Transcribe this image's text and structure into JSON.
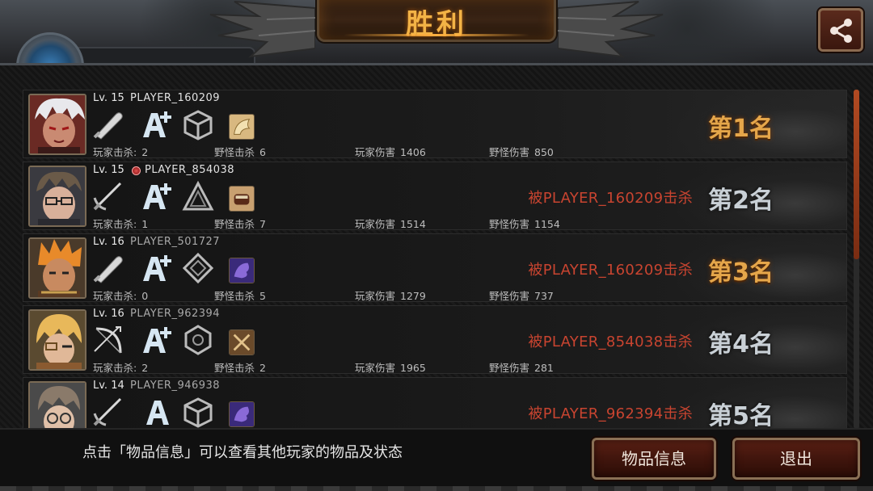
{
  "header": {
    "title": "胜利",
    "share_icon": "share-icon"
  },
  "colors": {
    "accent": "#f3b346",
    "killed_text": "#c84430",
    "button_bg": "#4a1a10"
  },
  "players": [
    {
      "level": "Lv. 15",
      "name": "PLAYER_160209",
      "is_self": false,
      "weapon": "bat-icon",
      "grade": "A+",
      "emblem": "cube-emblem-icon",
      "item": "wing-item-icon",
      "player_kills_label": "玩家击杀:",
      "player_kills": "2",
      "monster_kills_label": "野怪击杀",
      "monster_kills": "6",
      "player_damage_label": "玩家伤害",
      "player_damage": "1406",
      "monster_damage_label": "野怪伤害",
      "monster_damage": "850",
      "killed_by": "",
      "rank": "第1名"
    },
    {
      "level": "Lv. 15",
      "name": "PLAYER_854038",
      "is_self": true,
      "weapon": "rapier-icon",
      "grade": "A+",
      "emblem": "triangle-emblem-icon",
      "item": "glove-item-icon",
      "player_kills_label": "玩家击杀:",
      "player_kills": "1",
      "monster_kills_label": "野怪击杀",
      "monster_kills": "7",
      "player_damage_label": "玩家伤害",
      "player_damage": "1514",
      "monster_damage_label": "野怪伤害",
      "monster_damage": "1154",
      "killed_by": "被PLAYER_160209击杀",
      "rank": "第2名"
    },
    {
      "level": "Lv. 16",
      "name": "PLAYER_501727",
      "is_self": false,
      "weapon": "bat-icon",
      "grade": "A+",
      "emblem": "diamond-emblem-icon",
      "item": "purple-beast-item-icon",
      "player_kills_label": "玩家击杀:",
      "player_kills": "0",
      "monster_kills_label": "野怪击杀",
      "monster_kills": "5",
      "player_damage_label": "玩家伤害",
      "player_damage": "1279",
      "monster_damage_label": "野怪伤害",
      "monster_damage": "737",
      "killed_by": "被PLAYER_160209击杀",
      "rank": "第3名"
    },
    {
      "level": "Lv. 16",
      "name": "PLAYER_962394",
      "is_self": false,
      "weapon": "bow-icon",
      "grade": "A+",
      "emblem": "hexagon-emblem-icon",
      "item": "crossed-swords-item-icon",
      "player_kills_label": "玩家击杀:",
      "player_kills": "2",
      "monster_kills_label": "野怪击杀",
      "monster_kills": "2",
      "player_damage_label": "玩家伤害",
      "player_damage": "1965",
      "monster_damage_label": "野怪伤害",
      "monster_damage": "281",
      "killed_by": "被PLAYER_854038击杀",
      "rank": "第4名"
    },
    {
      "level": "Lv. 14",
      "name": "PLAYER_946938",
      "is_self": false,
      "weapon": "rapier-icon",
      "grade": "A",
      "emblem": "cube-emblem-icon",
      "item": "purple-beast-item-icon",
      "player_kills_label": "",
      "player_kills": "",
      "monster_kills_label": "",
      "monster_kills": "",
      "player_damage_label": "",
      "player_damage": "",
      "monster_damage_label": "",
      "monster_damage": "",
      "killed_by": "被PLAYER_962394击杀",
      "rank": "第5名"
    }
  ],
  "footer": {
    "hint": "点击「物品信息」可以查看其他玩家的物品及状态",
    "items_button": "物品信息",
    "exit_button": "退出"
  }
}
